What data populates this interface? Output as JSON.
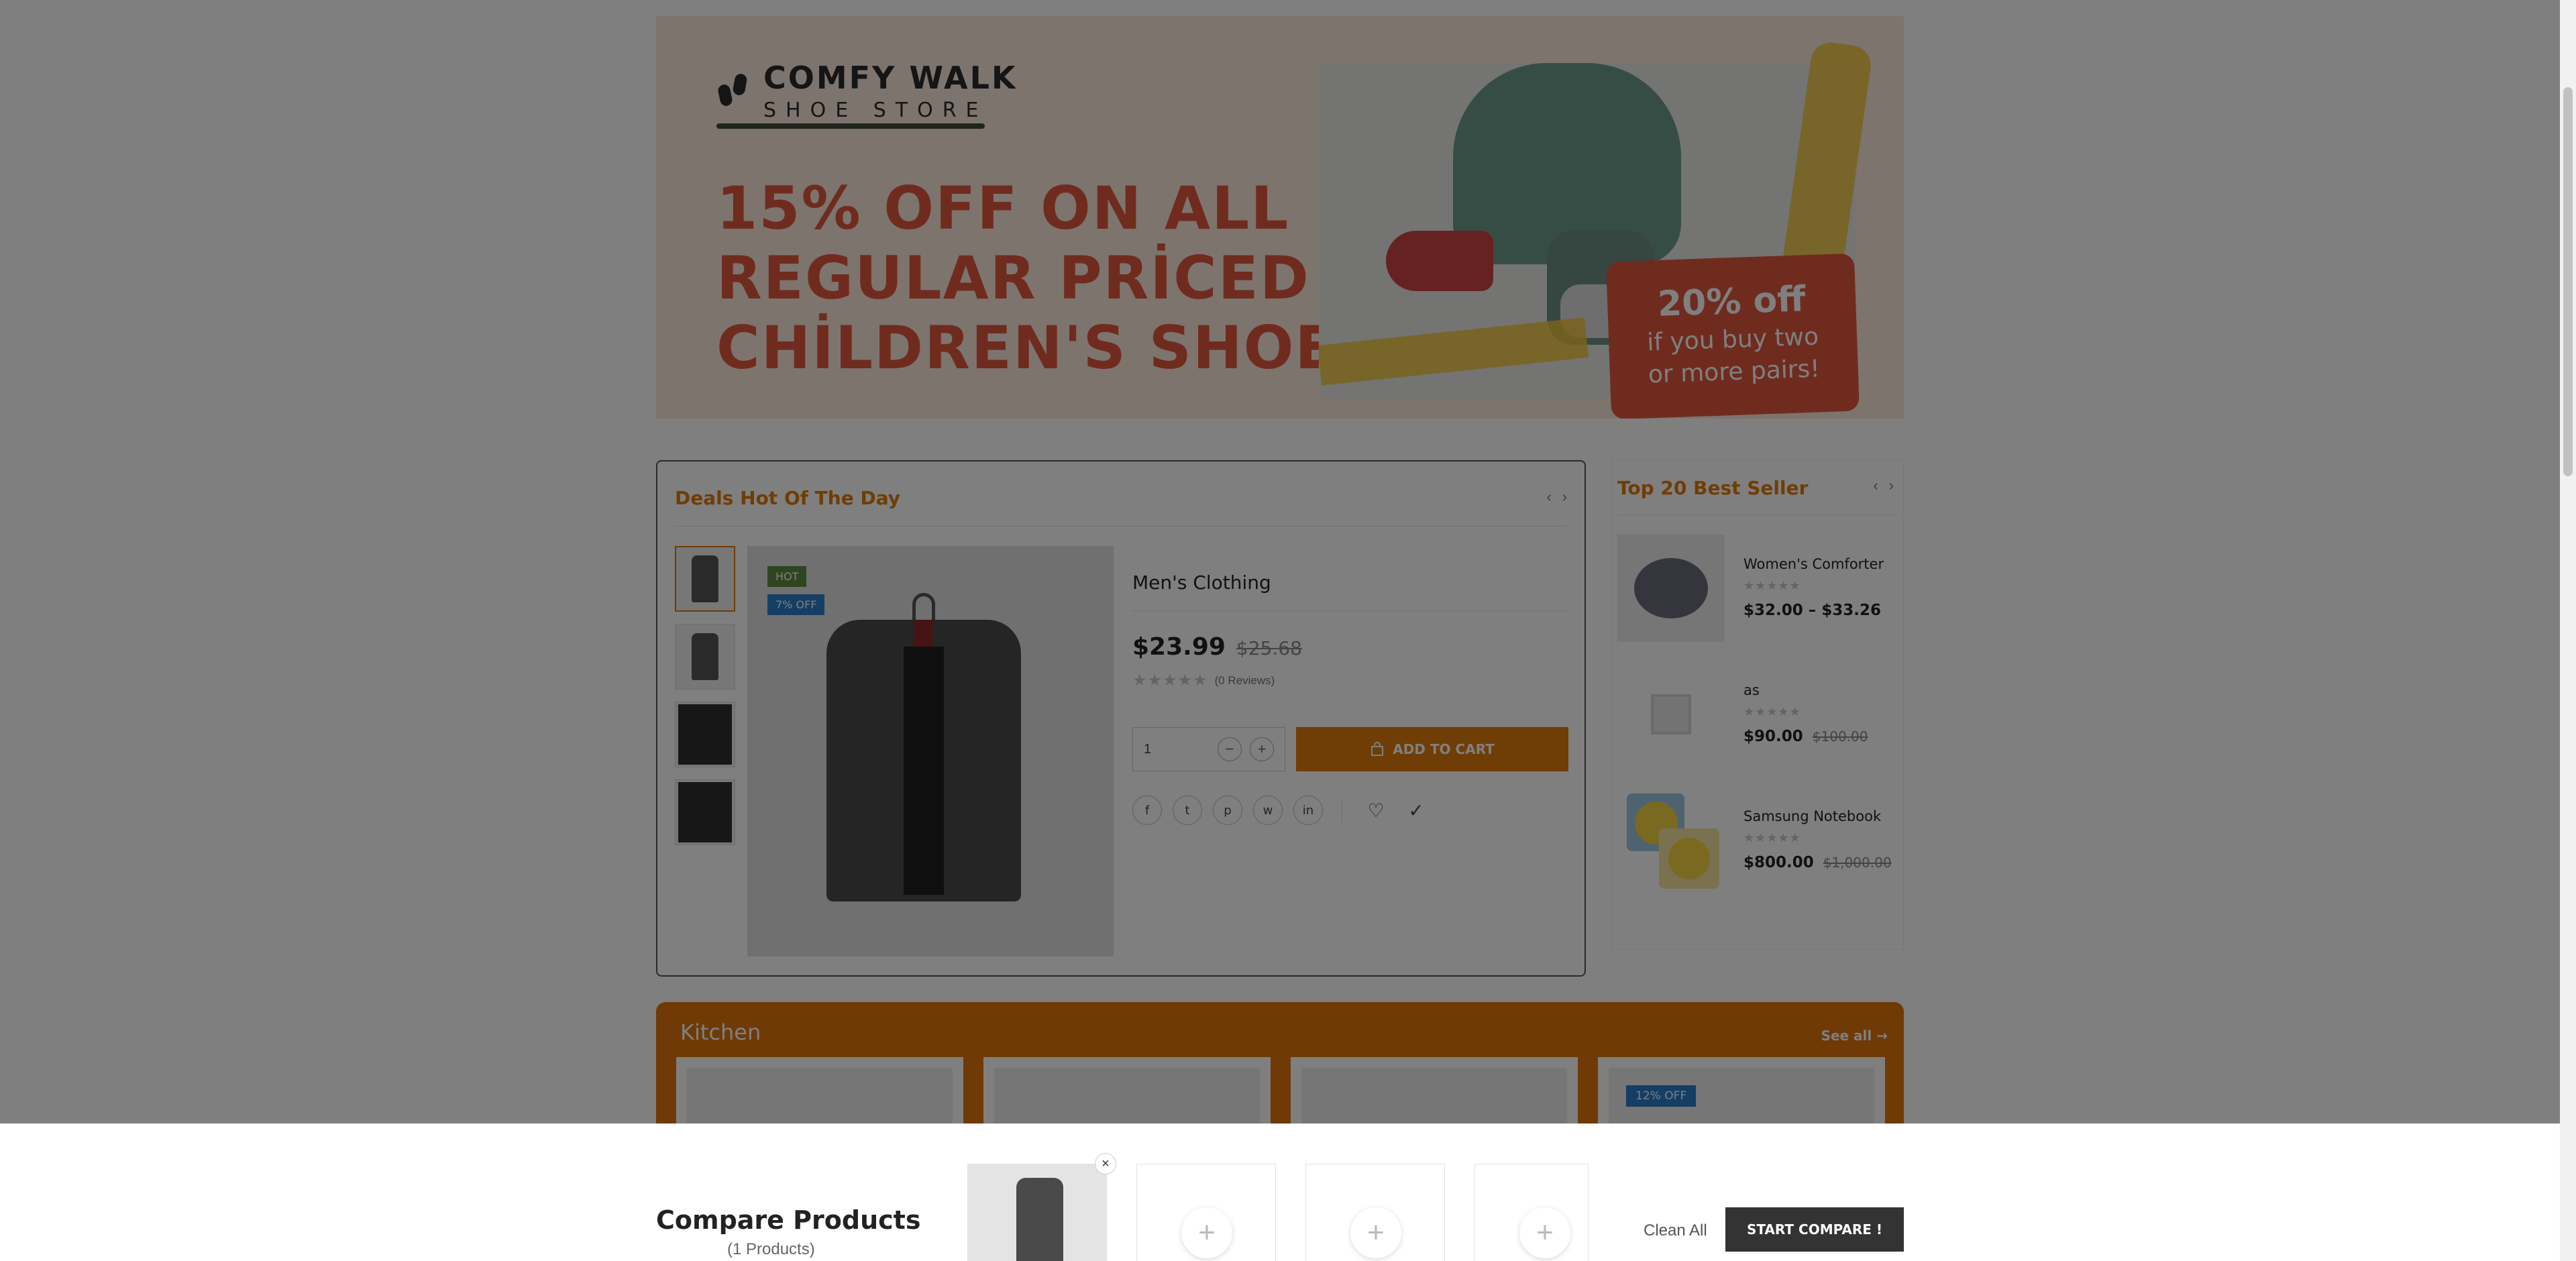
{
  "banner": {
    "brand_line1": "COMFY WALK",
    "brand_line2": "SHOE STORE",
    "headline_line1": "15% OFF ON ALL",
    "headline_line2": "REGULAR PRİCED",
    "headline_line3": "CHİLDREN'S SHOES",
    "promo_big": "20% off",
    "promo_small1": "if you buy two",
    "promo_small2": "or more pairs!"
  },
  "deals": {
    "title": "Deals Hot Of The Day",
    "badge_hot": "HOT",
    "badge_off": "7% OFF",
    "product_name": "Men's Clothing",
    "price": "$23.99",
    "price_old": "$25.68",
    "stars": "★★★★★",
    "reviews": "(0 Reviews)",
    "quantity": "1",
    "add_to_cart": "ADD TO CART",
    "social": [
      "f",
      "t",
      "p",
      "w",
      "in"
    ]
  },
  "bestseller": {
    "title": "Top 20 Best Seller",
    "items": [
      {
        "name": "Women's Comforter",
        "price": "$32.00 – $33.26",
        "price_old": ""
      },
      {
        "name": "as",
        "price": "$90.00",
        "price_old": "$100.00"
      },
      {
        "name": "Samsung Notebook",
        "price": "$800.00",
        "price_old": "$1,000.00"
      }
    ]
  },
  "kitchen": {
    "title": "Kitchen",
    "see_all": "See all →",
    "badge": "12% OFF"
  },
  "compare": {
    "title": "Compare Products",
    "count": "(1 Products)",
    "clean_all": "Clean All",
    "start": "START COMPARE !"
  },
  "colors": {
    "accent": "#e07a0c",
    "banner_red": "#e0563f",
    "badge_blue": "#2a7dc9",
    "badge_green": "#5f8b3f"
  }
}
